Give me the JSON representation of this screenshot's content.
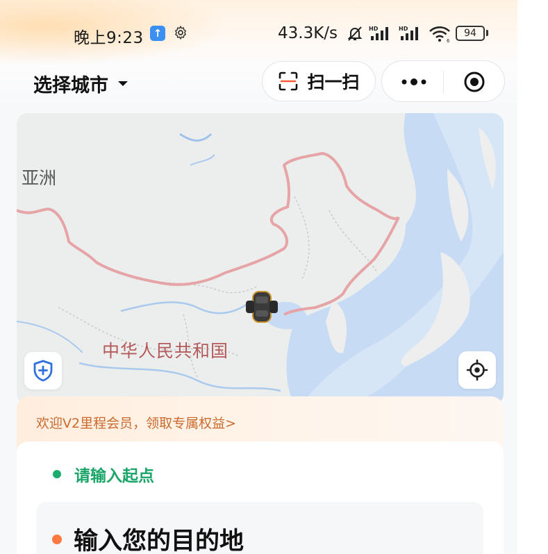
{
  "status_bar": {
    "time": "晚上9:23",
    "upload_icon": "arrow-up",
    "net_speed": "43.3K/s",
    "battery": "94",
    "icons": [
      "settings-gear",
      "bell-muted",
      "hd-signal",
      "hd-signal",
      "wifi"
    ]
  },
  "header": {
    "city_select": "选择城市",
    "scan_label": "扫一扫",
    "more_icon": "more-dots",
    "close_icon": "target-circle"
  },
  "map": {
    "label_asia": "亚洲",
    "label_china": "中华人民共和国",
    "marker": "car-marker",
    "shield_icon": "shield-plus",
    "locate_icon": "crosshair-locate"
  },
  "promo": {
    "text": "欢迎V2里程会员，领取专属权益>"
  },
  "trip": {
    "start_placeholder": "请输入起点",
    "destination_placeholder": "输入您的目的地"
  },
  "colors": {
    "accent_green": "#1aad6e",
    "accent_orange": "#ff7a40",
    "promo_text": "#cc6a2e",
    "border_red": "#e6a4a6"
  }
}
